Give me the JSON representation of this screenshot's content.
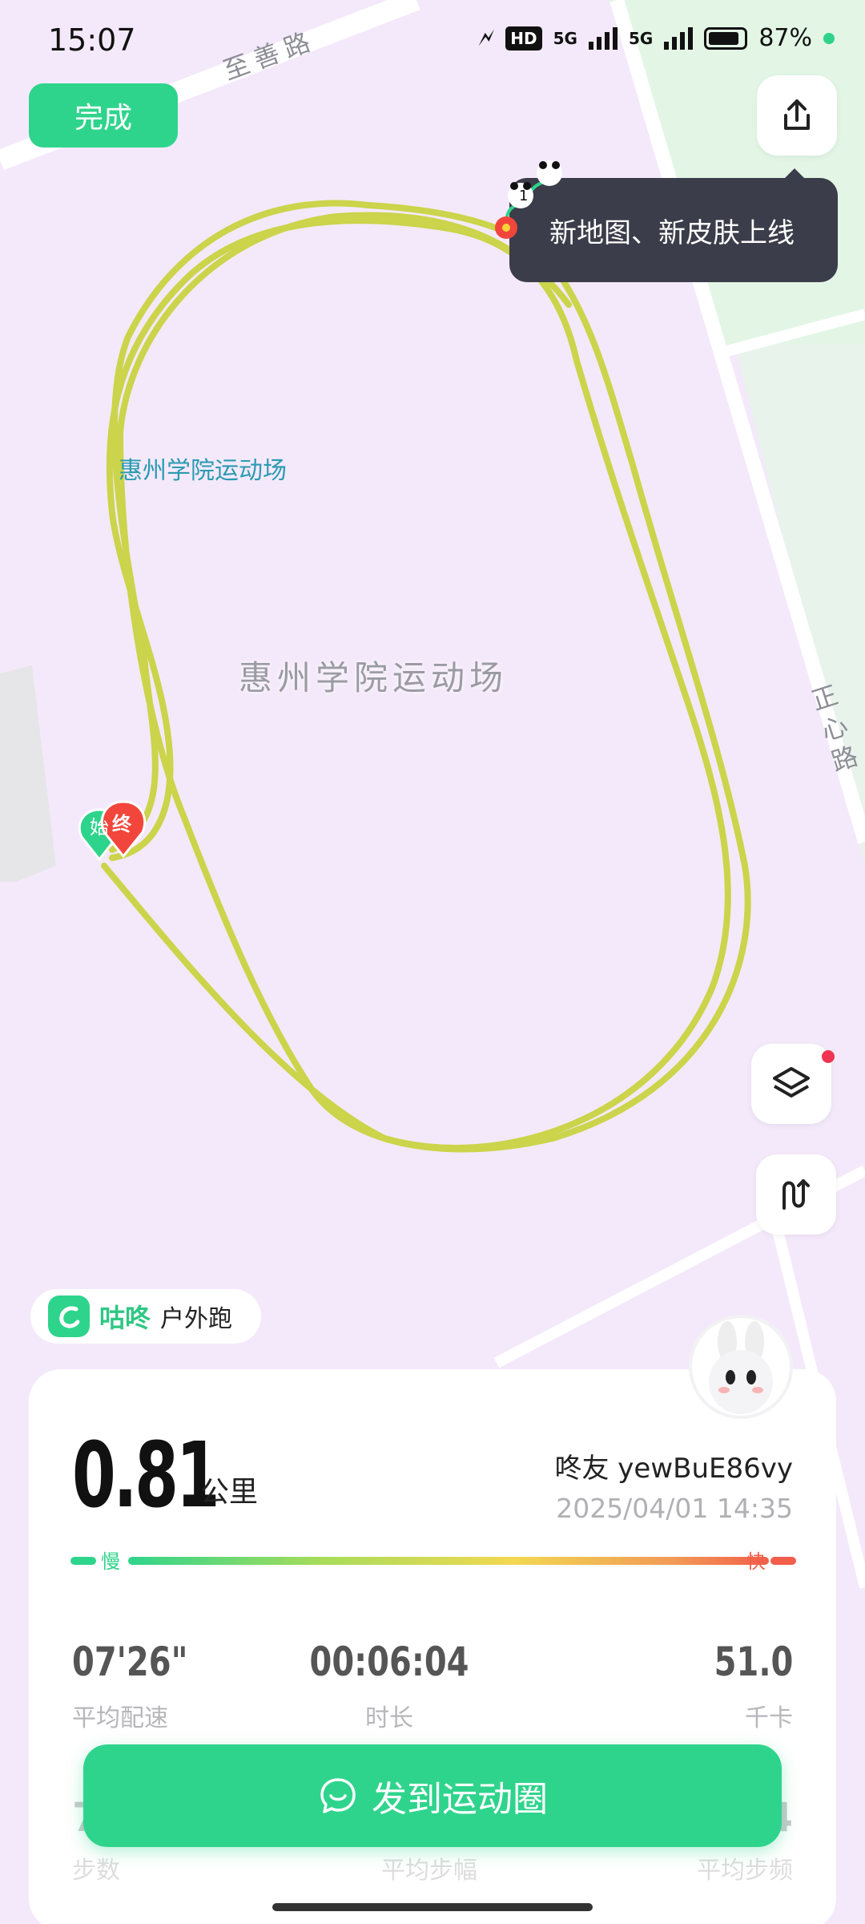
{
  "status_bar": {
    "time": "15:07",
    "hd_badge": "HD",
    "network_1": "5G",
    "network_2": "5G",
    "battery_text": "87%",
    "battery_level": 0.87
  },
  "toolbar": {
    "done_label": "完成"
  },
  "map": {
    "road_top": "至善路",
    "road_right": "正心路",
    "poi_label": "惠州学院运动场",
    "center_label": "惠州学院运动场",
    "start_marker": "始",
    "end_marker": "终"
  },
  "promo_tooltip": {
    "text": "新地图、新皮肤上线",
    "badge_number": "1"
  },
  "brand": {
    "name": "咕咚",
    "activity_type": "户外跑"
  },
  "summary": {
    "distance": "0.81",
    "distance_unit": "公里",
    "user_name": "咚友 yewBuE86vy",
    "datetime": "2025/04/01 14:35",
    "pace_scale": {
      "slow": "慢",
      "fast": "快"
    }
  },
  "stats": [
    {
      "value": "07'26\"",
      "label": "平均配速"
    },
    {
      "value": "00:06:04",
      "label": "时长"
    },
    {
      "value": "51.0",
      "label": "千卡"
    }
  ],
  "stats_partial": {
    "left_value": "7",
    "right_value": "4",
    "left_label": "步数",
    "center_label": "平均步幅",
    "right_label": "平均步频"
  },
  "post_button": {
    "label": "发到运动圈"
  },
  "colors": {
    "accent": "#2fd48c",
    "route": "#cbd44a",
    "map_bg": "#f4e9fa",
    "tooltip_bg": "#3c3d4a",
    "fast": "#f25e4a"
  }
}
